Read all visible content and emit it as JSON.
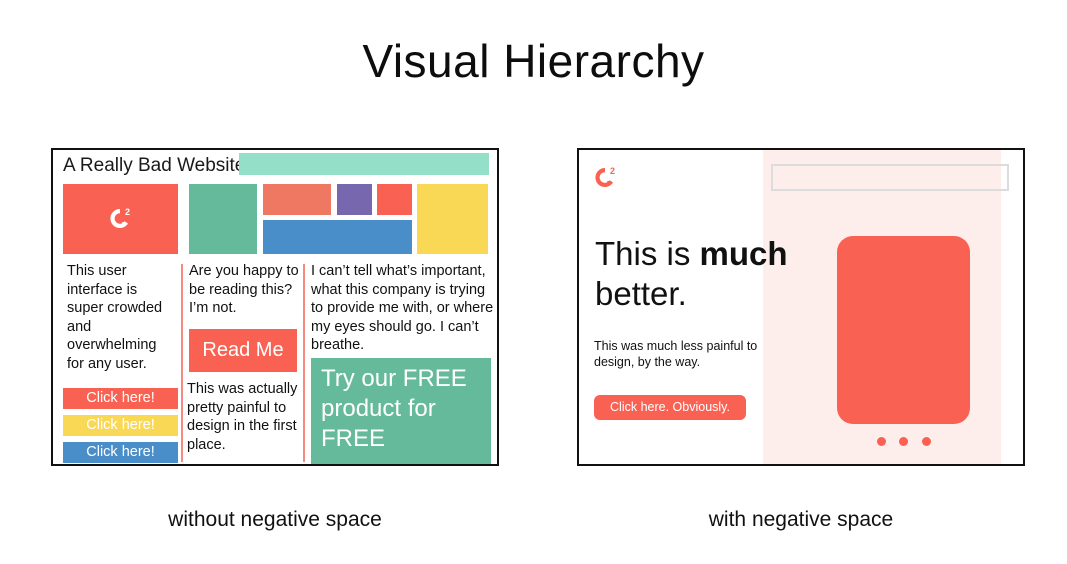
{
  "title": "Visual Hierarchy",
  "captions": {
    "left": "without negative space",
    "right": "with negative space"
  },
  "bad_site": {
    "site_title": "A Really Bad Website",
    "logo_icon": "g2-logo-icon",
    "column1_text": "This user interface is super crowded and overwhelming for any user.",
    "column2_text": "Are you happy to be reading this? I’m not.",
    "column2_text_bottom": "This was actually pretty painful to design in the first place.",
    "column3_text": "I can’t tell what’s important, what this company is trying to provide me with, or where my eyes should go. I can’t breathe.",
    "buttons": [
      {
        "label": "Click here!",
        "color": "#f96253"
      },
      {
        "label": "Click here!",
        "color": "#f9d856"
      },
      {
        "label": "Click here!",
        "color": "#4a8ec9"
      }
    ],
    "read_me_label": "Read Me",
    "promo_text": "Try our FREE product for FREE",
    "colors": {
      "mint": "#94dfc8",
      "red": "#f96253",
      "green": "#66ba9c",
      "salmon": "#ee7862",
      "purple": "#7767ae",
      "blue": "#4a8ec9",
      "yellow": "#f9d856"
    }
  },
  "good_site": {
    "logo_icon": "g2-logo-icon",
    "headline_regular": "This is ",
    "headline_bold": "much",
    "headline_line2": "better.",
    "subtext": "This was much less painful to design, by the way.",
    "cta_label": "Click here. Obviously.",
    "carousel_dots": 3,
    "colors": {
      "accent": "#f96253",
      "panel": "#fdeeec",
      "search_border": "#dcdcdc"
    }
  }
}
